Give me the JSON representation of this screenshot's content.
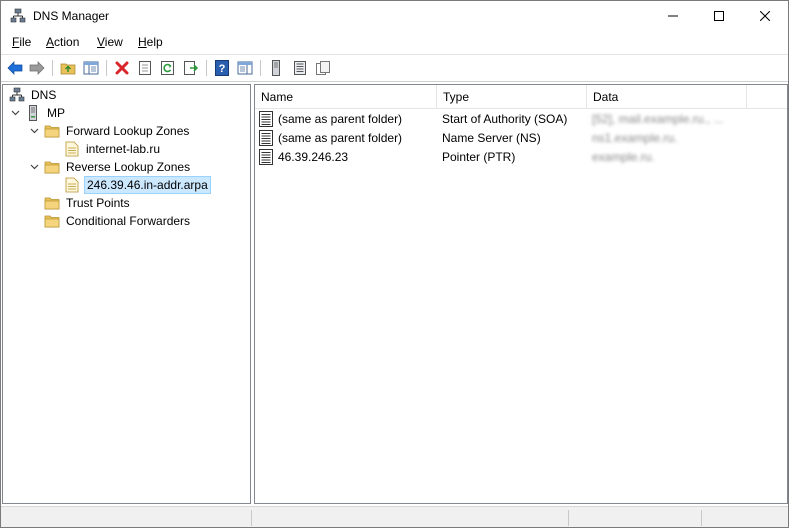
{
  "window": {
    "title": "DNS Manager"
  },
  "menu": [
    {
      "label": "File",
      "accel": "F",
      "rest": "ile"
    },
    {
      "label": "Action",
      "accel": "A",
      "rest": "ction"
    },
    {
      "label": "View",
      "accel": "V",
      "rest": "iew"
    },
    {
      "label": "Help",
      "accel": "H",
      "rest": "elp"
    }
  ],
  "toolbar": {
    "items": [
      "back-arrow-icon",
      "forward-arrow-icon",
      "up-folder-icon",
      "show-hide-tree-icon",
      "delete-icon",
      "properties-icon",
      "refresh-icon",
      "export-list-icon",
      "help-icon",
      "show-hide-action-pane-icon",
      "server-icon",
      "list-icon",
      "copy-icon"
    ]
  },
  "tree": {
    "root": "DNS",
    "server": "MP",
    "forward_zones": "Forward Lookup Zones",
    "forward_zone_child": "internet-lab.ru",
    "reverse_zones": "Reverse Lookup Zones",
    "reverse_zone_child": "246.39.46.in-addr.arpa",
    "trust_points": "Trust Points",
    "conditional_forwarders": "Conditional Forwarders"
  },
  "list": {
    "columns": {
      "name": "Name",
      "type": "Type",
      "data": "Data"
    },
    "rows": [
      {
        "name": "(same as parent folder)",
        "type": "Start of Authority (SOA)",
        "data": "[52], mail.example.ru., ..."
      },
      {
        "name": "(same as parent folder)",
        "type": "Name Server (NS)",
        "data": "ns1.example.ru."
      },
      {
        "name": "46.39.246.23",
        "type": "Pointer (PTR)",
        "data": "example.ru."
      }
    ]
  },
  "colors": {
    "selection": "#cce8ff",
    "folder": "#e8c15a",
    "accent": "#1e6fd9"
  }
}
